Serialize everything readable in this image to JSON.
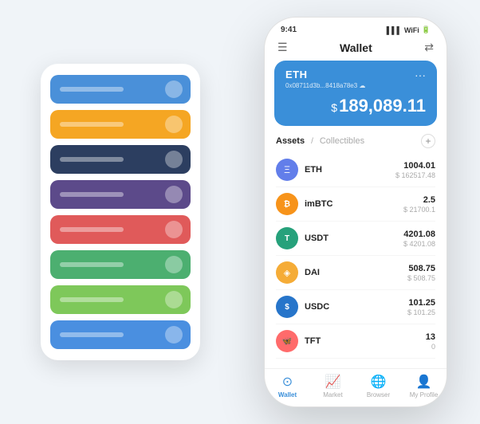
{
  "scene": {
    "background": "#f0f4f8"
  },
  "cardStack": {
    "cards": [
      {
        "color": "card-blue",
        "label": "Blue card"
      },
      {
        "color": "card-orange",
        "label": "Orange card"
      },
      {
        "color": "card-dark",
        "label": "Dark card"
      },
      {
        "color": "card-purple",
        "label": "Purple card"
      },
      {
        "color": "card-red",
        "label": "Red card"
      },
      {
        "color": "card-green",
        "label": "Green card"
      },
      {
        "color": "card-light-green",
        "label": "Light green card"
      },
      {
        "color": "card-blue2",
        "label": "Blue2 card"
      }
    ]
  },
  "phone": {
    "statusBar": {
      "time": "9:41",
      "signal": "▌▌▌",
      "wifi": "WiFi",
      "battery": "🔋"
    },
    "header": {
      "menuIcon": "☰",
      "title": "Wallet",
      "scanIcon": "⇄"
    },
    "ethCard": {
      "label": "ETH",
      "address": "0x08711d3b...8418a78e3 ☁",
      "menuDots": "···",
      "dollarSign": "$",
      "amount": "189,089.11"
    },
    "assets": {
      "activeTab": "Assets",
      "divider": "/",
      "inactiveTab": "Collectibles",
      "addIcon": "+"
    },
    "assetList": [
      {
        "symbol": "ETH",
        "iconLabel": "Ξ",
        "iconClass": "icon-eth",
        "quantity": "1004.01",
        "usdValue": "$ 162517.48"
      },
      {
        "symbol": "imBTC",
        "iconLabel": "₿",
        "iconClass": "icon-imbtc",
        "quantity": "2.5",
        "usdValue": "$ 21700.1"
      },
      {
        "symbol": "USDT",
        "iconLabel": "T",
        "iconClass": "icon-usdt",
        "quantity": "4201.08",
        "usdValue": "$ 4201.08"
      },
      {
        "symbol": "DAI",
        "iconLabel": "◈",
        "iconClass": "icon-dai",
        "quantity": "508.75",
        "usdValue": "$ 508.75"
      },
      {
        "symbol": "USDC",
        "iconLabel": "$",
        "iconClass": "icon-usdc",
        "quantity": "101.25",
        "usdValue": "$ 101.25"
      },
      {
        "symbol": "TFT",
        "iconLabel": "🦋",
        "iconClass": "icon-tft",
        "quantity": "13",
        "usdValue": "0"
      }
    ],
    "bottomNav": [
      {
        "icon": "⊙",
        "label": "Wallet",
        "active": true
      },
      {
        "icon": "📈",
        "label": "Market",
        "active": false
      },
      {
        "icon": "🌐",
        "label": "Browser",
        "active": false
      },
      {
        "icon": "👤",
        "label": "My Profile",
        "active": false
      }
    ]
  }
}
